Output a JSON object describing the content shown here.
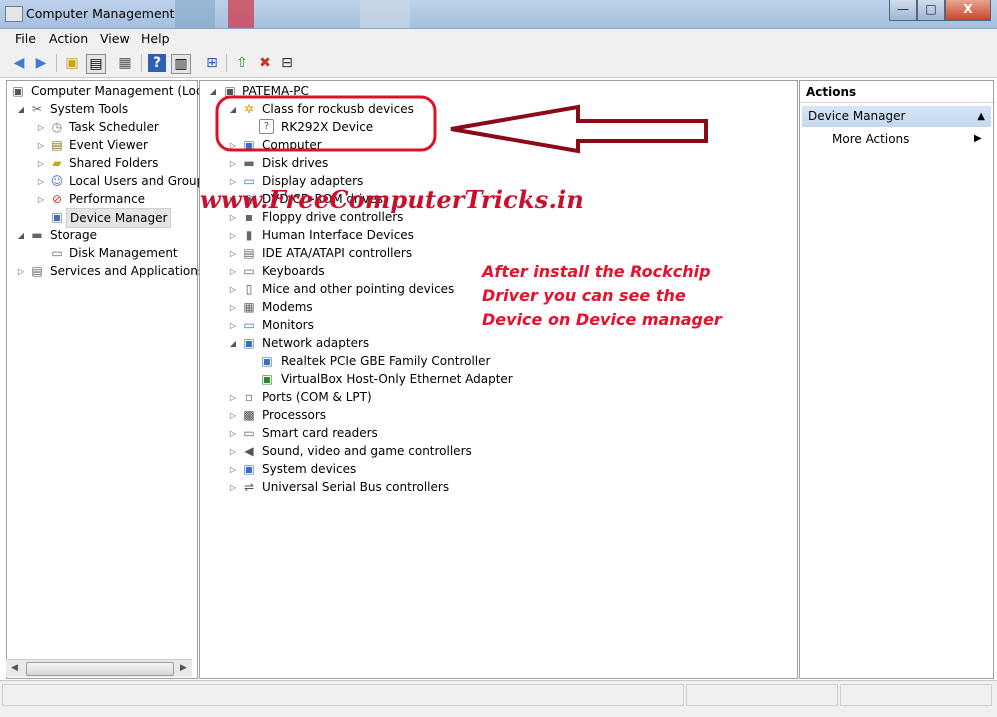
{
  "window": {
    "title": "Computer Management",
    "min_label": "—",
    "max_label": "□",
    "close_label": "X"
  },
  "menu": {
    "file": "File",
    "action": "Action",
    "view": "View",
    "help": "Help"
  },
  "left_tree": {
    "root": "Computer Management (Local",
    "system_tools": "System Tools",
    "task_scheduler": "Task Scheduler",
    "event_viewer": "Event Viewer",
    "shared_folders": "Shared Folders",
    "local_users": "Local Users and Groups",
    "performance": "Performance",
    "device_manager": "Device Manager",
    "storage": "Storage",
    "disk_management": "Disk Management",
    "services": "Services and Applications"
  },
  "device_tree": {
    "host": "PATEMA-PC",
    "rockusb": "Class for rockusb devices",
    "rk292x": "RK292X Device",
    "computer": "Computer",
    "disk_drives": "Disk drives",
    "display": "Display adapters",
    "dvd": "DVD/CD-ROM drives",
    "floppy": "Floppy drive controllers",
    "hid": "Human Interface Devices",
    "ide": "IDE ATA/ATAPI controllers",
    "keyboards": "Keyboards",
    "mice": "Mice and other pointing devices",
    "modems": "Modems",
    "monitors": "Monitors",
    "network": "Network adapters",
    "realtek": "Realtek PCIe GBE Family Controller",
    "virtualbox": "VirtualBox Host-Only Ethernet Adapter",
    "ports": "Ports (COM & LPT)",
    "processors": "Processors",
    "smartcard": "Smart card readers",
    "sound": "Sound, video and game controllers",
    "system_devices": "System devices",
    "usb": "Universal Serial Bus controllers"
  },
  "actions": {
    "header": "Actions",
    "device_manager": "Device Manager",
    "more_actions": "More Actions"
  },
  "overlay": {
    "watermark": "www.FreeComputerTricks.in",
    "note_line1": "After install the Rockchip",
    "note_line2": "Driver you can see the",
    "note_line3": "Device on Device manager"
  },
  "colors": {
    "annotation_red": "#e8102a",
    "circle_red": "#e0102a",
    "arrow_red": "#8b0a1a",
    "selection": "#e5e5e5",
    "actions_band": "#c9dcef"
  }
}
